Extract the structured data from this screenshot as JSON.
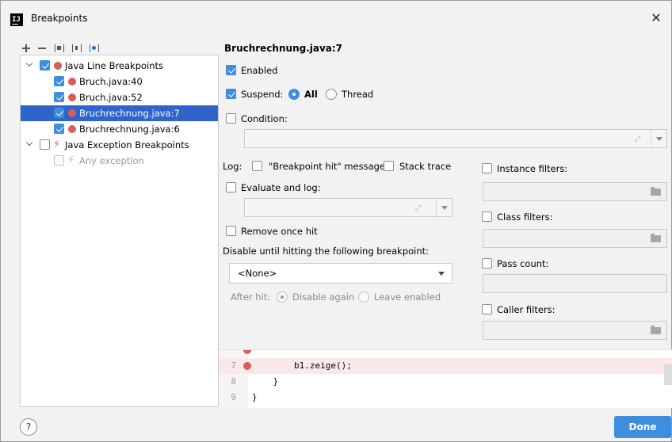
{
  "window": {
    "title": "Breakpoints",
    "app_icon_text": "IJ",
    "close_glyph": "✕"
  },
  "toolbar": {
    "items": [
      "add-icon",
      "remove-icon",
      "group-by-package-icon",
      "group-by-class-icon",
      "group-by-file-icon"
    ]
  },
  "tree": {
    "groups": [
      {
        "label": "Java Line Breakpoints",
        "checked": true,
        "items": [
          {
            "label": "Bruch.java:40",
            "checked": true
          },
          {
            "label": "Bruch.java:52",
            "checked": true
          },
          {
            "label": "Bruchrechnung.java:7",
            "checked": true,
            "selected": true
          },
          {
            "label": "Bruchrechnung.java:6",
            "checked": true
          }
        ]
      },
      {
        "label": "Java Exception Breakpoints",
        "checked": false,
        "items": [
          {
            "label": "Any exception",
            "checked": false,
            "disabled": true
          }
        ]
      }
    ]
  },
  "details": {
    "title": "Bruchrechnung.java:7",
    "enabled": {
      "label": "Enabled",
      "checked": true
    },
    "suspend": {
      "label": "Suspend:",
      "checked": true,
      "options": [
        "All",
        "Thread"
      ],
      "selected": "All"
    },
    "condition": {
      "label": "Condition:",
      "checked": false,
      "value": ""
    },
    "log": {
      "label": "Log:",
      "hit_message": {
        "label": "\"Breakpoint hit\" message",
        "checked": false
      },
      "stack_trace": {
        "label": "Stack trace",
        "checked": false
      }
    },
    "evaluate": {
      "label": "Evaluate and log:",
      "checked": false,
      "value": ""
    },
    "remove_once_hit": {
      "label": "Remove once hit",
      "checked": false
    },
    "disable_until": {
      "label": "Disable until hitting the following breakpoint:",
      "value": "<None>"
    },
    "after_hit": {
      "label": "After hit:",
      "options": [
        "Disable again",
        "Leave enabled"
      ],
      "selected": "Disable again"
    },
    "filters": [
      {
        "label": "Instance filters:",
        "checked": false,
        "value": ""
      },
      {
        "label": "Class filters:",
        "checked": false,
        "value": ""
      },
      {
        "label": "Pass count:",
        "checked": false,
        "value": ""
      },
      {
        "label": "Caller filters:",
        "checked": false,
        "value": ""
      }
    ]
  },
  "code_preview": {
    "lines": [
      {
        "number": "",
        "text": "",
        "breakpoint": true
      },
      {
        "number": "7",
        "text": "        b1.zeige();",
        "breakpoint": true,
        "highlight": true
      },
      {
        "number": "8",
        "text": "    }",
        "breakpoint": false
      },
      {
        "number": "9",
        "text": "}",
        "breakpoint": false
      }
    ]
  },
  "footer": {
    "help_label": "?",
    "done_label": "Done"
  },
  "colors": {
    "accent": "#3f8ddd",
    "selection": "#2f65ca",
    "breakpoint": "#db5c5c",
    "highlight_line": "#fbe9e9"
  }
}
